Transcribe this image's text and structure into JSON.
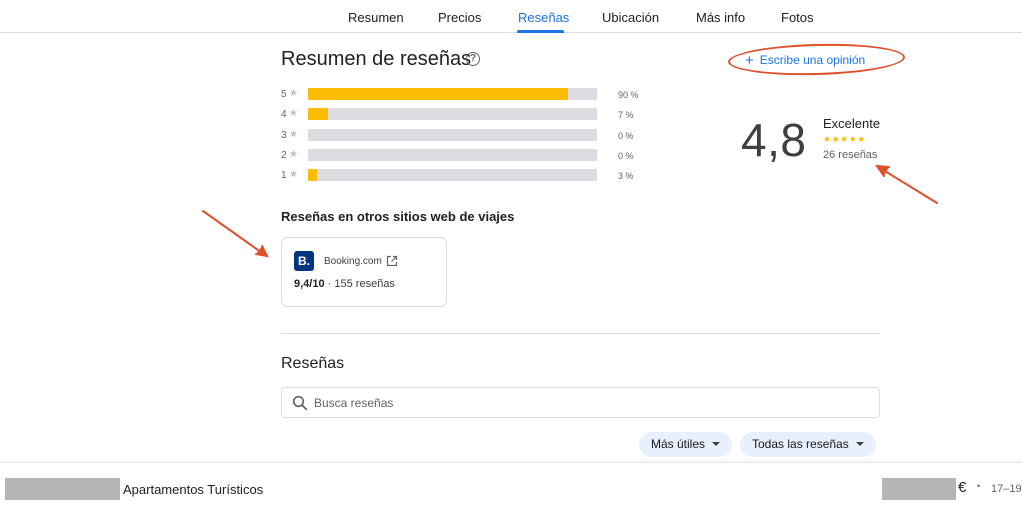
{
  "tabs": [
    {
      "label": "Resumen",
      "active": false
    },
    {
      "label": "Precios",
      "active": false
    },
    {
      "label": "Reseñas",
      "active": true
    },
    {
      "label": "Ubicación",
      "active": false
    },
    {
      "label": "Más info",
      "active": false
    },
    {
      "label": "Fotos",
      "active": false
    }
  ],
  "summary": {
    "title": "Resumen de reseñas",
    "help_icon": "?",
    "write_review_label": "Escribe una opinión",
    "plus_icon": "+",
    "distribution": [
      {
        "stars": "5",
        "percent_label": "90 %",
        "fraction": 0.9
      },
      {
        "stars": "4",
        "percent_label": "7 %",
        "fraction": 0.07
      },
      {
        "stars": "3",
        "percent_label": "0 %",
        "fraction": 0
      },
      {
        "stars": "2",
        "percent_label": "0 %",
        "fraction": 0
      },
      {
        "stars": "1",
        "percent_label": "3 %",
        "fraction": 0.03
      }
    ],
    "star_glyph": "★",
    "score": "4,8",
    "score_word": "Excelente",
    "score_stars": "★★★★★",
    "review_count": "26 reseñas"
  },
  "other_sites": {
    "title": "Reseñas en otros sitios web de viajes",
    "sites": [
      {
        "logo_letter": "B.",
        "name": "Booking.com",
        "score": "9,4/10",
        "separator": "·",
        "count": "155 reseñas"
      }
    ]
  },
  "reviews": {
    "title": "Reseñas",
    "search_placeholder": "Busca reseñas",
    "sort_label": "Más útiles",
    "filter_label": "Todas las reseñas"
  },
  "bottom_bar": {
    "hotel_name": "Apartamentos Turísticos",
    "currency": "€",
    "separator": "•",
    "dates": "17–19"
  },
  "colors": {
    "accent": "#1a73e8",
    "star": "#fbbc04",
    "annotation": "#e0502a",
    "booking_brand": "#003580"
  }
}
